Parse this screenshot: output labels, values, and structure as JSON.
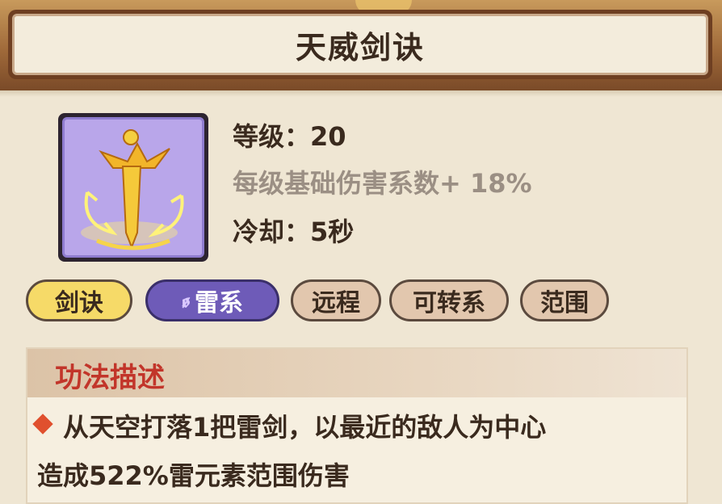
{
  "title": "天威剑诀",
  "stats": {
    "level": "等级：20",
    "per_level": "每级基础伤害系数+ 18%",
    "cooldown": "冷却：5秒"
  },
  "skill_icon": "thunder-sword-icon",
  "tags": {
    "sword": "剑诀",
    "thunder_symbol": "ꬾ",
    "thunder": "雷系",
    "ranged": "远程",
    "convertible": "可转系",
    "area": "范围"
  },
  "description": {
    "header": "功法描述",
    "line1": "从天空打落1把雷剑，以最近的敌人为中心",
    "line2": "造成522%雷元素范围伤害"
  },
  "colors": {
    "title_text": "#3a2a1e",
    "icon_bg": "#b9a6ea",
    "tag_sword": "#f6da68",
    "tag_thunder": "#6e5bb8",
    "tag_default": "#e2c7ae",
    "desc_header_text": "#c2352a"
  }
}
